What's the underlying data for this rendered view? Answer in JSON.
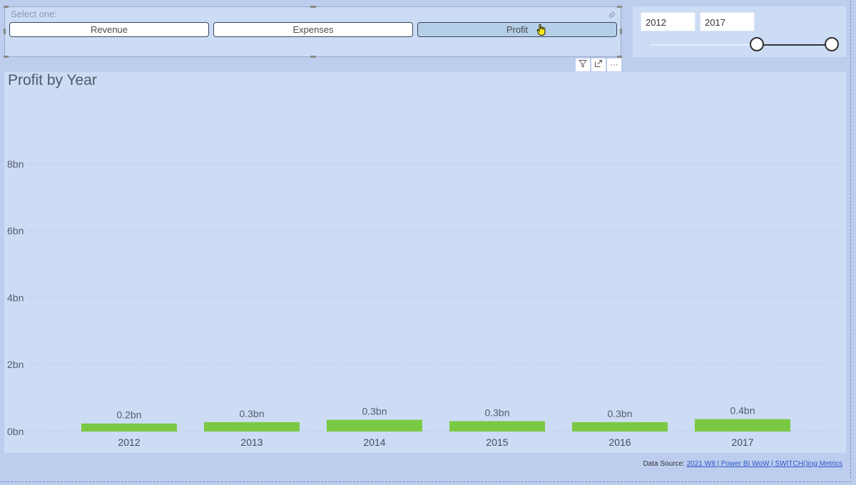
{
  "slicer": {
    "label": "Select one:",
    "options": [
      {
        "label": "Revenue",
        "selected": false
      },
      {
        "label": "Expenses",
        "selected": false
      },
      {
        "label": "Profit",
        "selected": true
      }
    ]
  },
  "visual_header": {
    "icons": [
      "filter-icon",
      "focus-mode-icon",
      "more-options-icon"
    ],
    "more_label": "···"
  },
  "range_slicer": {
    "start_value": "2012",
    "end_value": "2017",
    "min": 2012,
    "max": 2017,
    "handle_start_fraction": 0.59,
    "handle_end_fraction": 1.0
  },
  "chart_data": {
    "type": "bar",
    "title": "Profit by Year",
    "categories": [
      "2012",
      "2013",
      "2014",
      "2015",
      "2016",
      "2017"
    ],
    "values": [
      0.24,
      0.28,
      0.35,
      0.31,
      0.28,
      0.37
    ],
    "data_labels": [
      "0.2bn",
      "0.3bn",
      "0.3bn",
      "0.3bn",
      "0.3bn",
      "0.4bn"
    ],
    "y_ticks": [
      {
        "value": 0,
        "label": "0bn"
      },
      {
        "value": 2,
        "label": "2bn"
      },
      {
        "value": 4,
        "label": "4bn"
      },
      {
        "value": 6,
        "label": "6bn"
      },
      {
        "value": 8,
        "label": "8bn"
      }
    ],
    "ylim": [
      0,
      10
    ],
    "grid": true,
    "bar_color": "#7ac943"
  },
  "footer": {
    "source_prefix": "Data Source:",
    "source_link": "2021 W8 | Power BI WoW | SWITCH()ing Metrics"
  },
  "colors": {
    "background": "#bccdee",
    "panel": "#cddcf5",
    "selected_button": "#b5cfe9",
    "bar": "#7ac943"
  }
}
